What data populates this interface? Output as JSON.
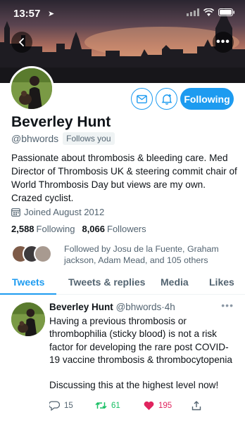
{
  "status": {
    "time": "13:57"
  },
  "profile": {
    "name": "Beverley Hunt",
    "handle": "@bhwords",
    "follows_you": "Follows you",
    "bio": "Passionate about thrombosis & bleeding care. Med Director of Thrombosis UK & steering commit chair of World Thrombosis Day but views are my own. Crazed cyclist.",
    "joined": "Joined August 2012",
    "following_count": "2,588",
    "following_label": "Following",
    "followers_count": "8,066",
    "followers_label": "Followers",
    "followed_by": "Followed by Josu de la Fuente, Graham jackson, Adam Mead, and 105 others"
  },
  "actions": {
    "follow_button": "Following"
  },
  "tabs": [
    {
      "label": "Tweets"
    },
    {
      "label": "Tweets & replies"
    },
    {
      "label": "Media"
    },
    {
      "label": "Likes"
    }
  ],
  "tweet": {
    "name": "Beverley Hunt",
    "handle": "@bhwords",
    "separator": "·",
    "time": "4h",
    "text": "Having a previous thrombosis or thrombophilia (sticky blood) is not a risk factor for developing the rare post COVID-19 vaccine thrombosis & thrombocytopenia\n\nDiscussing this at the highest level now!",
    "replies": "15",
    "retweets": "61",
    "likes": "195"
  },
  "icons": {
    "back": "back-arrow-icon",
    "more": "more-dots-icon",
    "mail": "mail-icon",
    "bell": "bell-add-icon",
    "calendar": "calendar-icon",
    "reply": "reply-icon",
    "retweet": "retweet-icon",
    "like": "heart-icon",
    "share": "share-icon"
  },
  "colors": {
    "accent": "#1d9bf0",
    "retweet": "#17bf63",
    "like": "#e0245e",
    "muted": "#536471"
  }
}
